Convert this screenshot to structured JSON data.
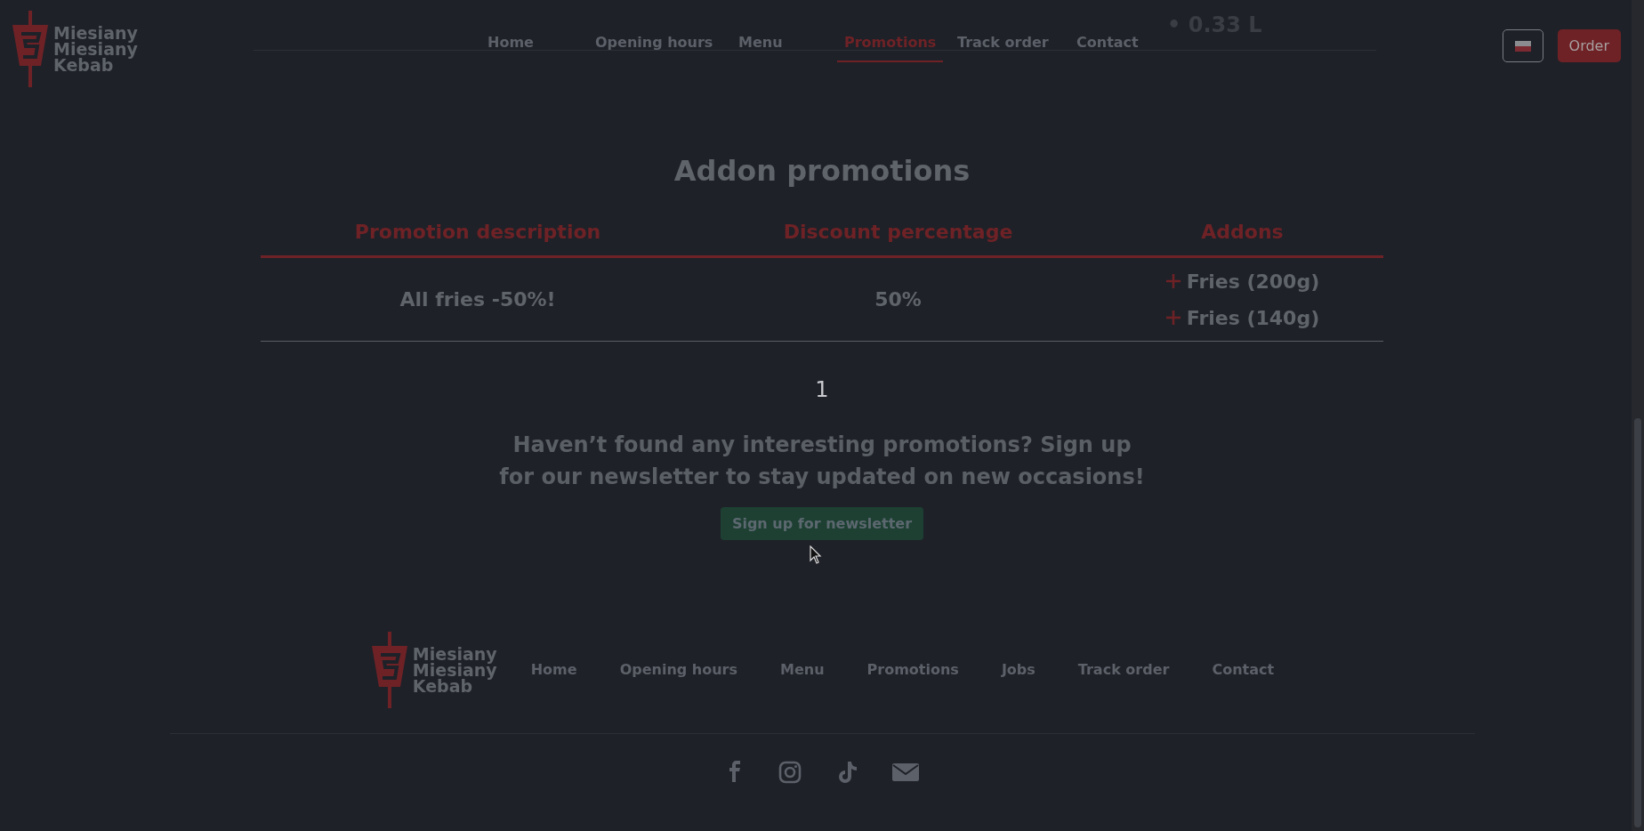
{
  "background_text": "• 0.33 L",
  "header": {
    "logo": {
      "lines": [
        "Miesiany",
        "Miesiany",
        "Kebab"
      ]
    },
    "nav": [
      {
        "label": "Home",
        "selected": false
      },
      {
        "label": "Opening hours",
        "selected": false
      },
      {
        "label": "Menu",
        "selected": false
      },
      {
        "label": "Promotions",
        "selected": true
      },
      {
        "label": "Track order",
        "selected": false
      },
      {
        "label": "Contact",
        "selected": false
      }
    ],
    "order_button": "Order"
  },
  "addon_promotions": {
    "title": "Addon promotions",
    "columns": [
      "Promotion description",
      "Discount percentage",
      "Addons"
    ],
    "rows": [
      {
        "description": "All fries -50%!",
        "discount": "50%",
        "addons": [
          "Fries (200g)",
          "Fries (140g)"
        ]
      }
    ]
  },
  "pagination": {
    "pages": [
      {
        "label": "1",
        "selected": true
      }
    ]
  },
  "newsletter": {
    "text": "Haven’t found any interesting promotions? Sign up for our newsletter to stay updated on new occasions!",
    "button": "Sign up for newsletter"
  },
  "footer": {
    "logo": {
      "lines": [
        "Miesiany",
        "Miesiany",
        "Kebab"
      ]
    },
    "nav": [
      "Home",
      "Opening hours",
      "Menu",
      "Promotions",
      "Jobs",
      "Track order",
      "Contact"
    ],
    "social": [
      {
        "kind": "facebook"
      },
      {
        "kind": "instagram"
      },
      {
        "kind": "tiktok"
      },
      {
        "kind": "email"
      }
    ]
  }
}
